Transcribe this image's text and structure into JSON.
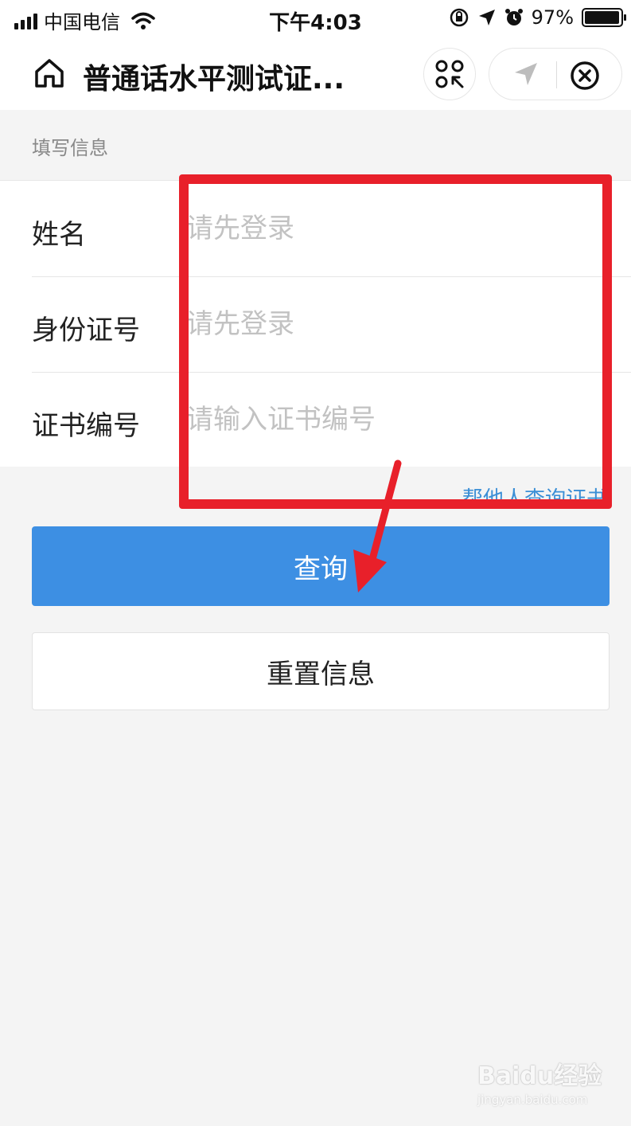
{
  "status_bar": {
    "carrier": "中国电信",
    "time": "下午4:03",
    "battery_percent": "97%",
    "battery_level": 0.97,
    "icons": [
      "signal-icon",
      "wifi-icon",
      "rotation-lock-icon",
      "location-icon",
      "alarm-icon",
      "battery-icon"
    ]
  },
  "nav_bar": {
    "title": "普通话水平测试证...",
    "icons": [
      "home-icon",
      "qr-scan-icon",
      "location-arrow-icon",
      "close-icon"
    ]
  },
  "form": {
    "section_title": "填写信息",
    "fields": [
      {
        "label": "姓名",
        "placeholder": "请先登录",
        "value": ""
      },
      {
        "label": "身份证号",
        "placeholder": "请先登录",
        "value": ""
      },
      {
        "label": "证书编号",
        "placeholder": "请输入证书编号",
        "value": ""
      }
    ],
    "help_link": "帮他人查询证书"
  },
  "buttons": {
    "query": "查询",
    "reset": "重置信息"
  },
  "annotation": {
    "color": "#e8202a"
  },
  "watermark": {
    "brand": "Baidu经验",
    "url": "jingyan.baidu.com"
  },
  "colors": {
    "primary": "#3d8fe3",
    "link": "#3b8fd6",
    "background": "#f4f4f4"
  }
}
